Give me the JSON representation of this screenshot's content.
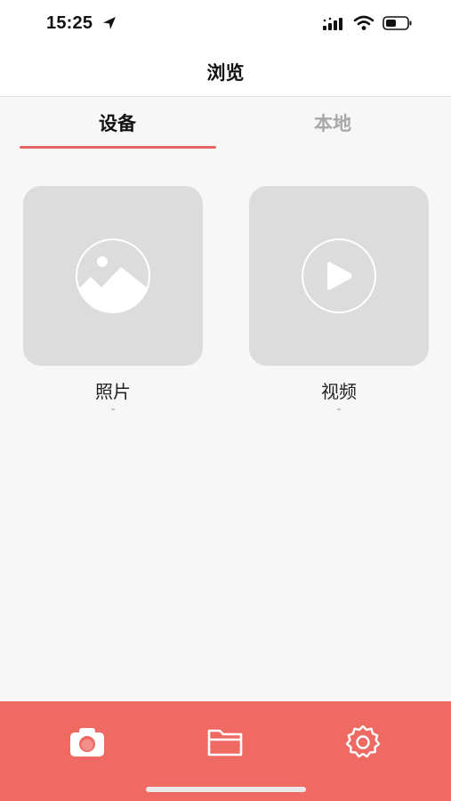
{
  "status_bar": {
    "time": "15:25",
    "icons": [
      "location-arrow-icon",
      "cellular-signal-icon",
      "wifi-icon",
      "battery-icon"
    ]
  },
  "nav": {
    "title": "浏览"
  },
  "tabs": {
    "items": [
      {
        "label": "设备",
        "active": true
      },
      {
        "label": "本地",
        "active": false
      }
    ],
    "indicator_color": "#e36762"
  },
  "media": {
    "photos": {
      "label": "照片",
      "count": "-",
      "icon": "image-icon"
    },
    "videos": {
      "label": "视频",
      "count": "-",
      "icon": "play-icon"
    }
  },
  "tab_bar": {
    "background": "#ef6a63",
    "items": [
      "camera-icon",
      "folder-icon",
      "settings-gear-icon"
    ]
  }
}
